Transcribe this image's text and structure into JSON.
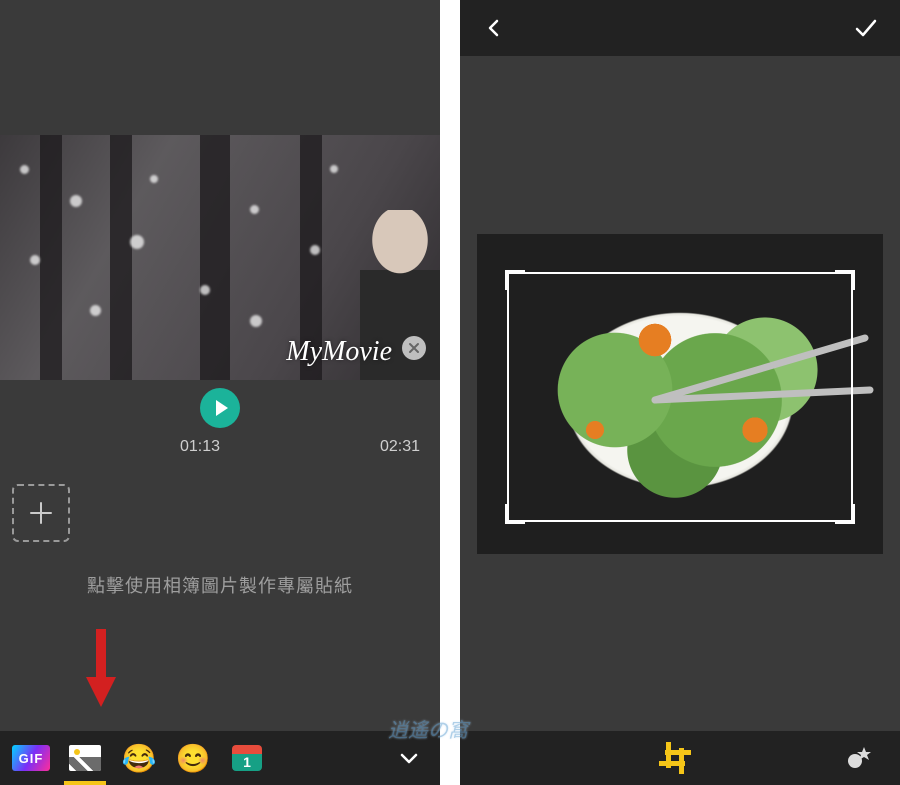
{
  "left": {
    "watermark": "MyMovie",
    "current_time": "01:13",
    "total_time": "02:31",
    "hint": "點擊使用相簿圖片製作專屬貼紙",
    "toolbar": {
      "gif_label": "GIF",
      "calendar_badge": "1"
    }
  },
  "right": {
    "crop": {
      "active_tool": "crop"
    }
  },
  "blog_watermark": "逍遙の窩"
}
